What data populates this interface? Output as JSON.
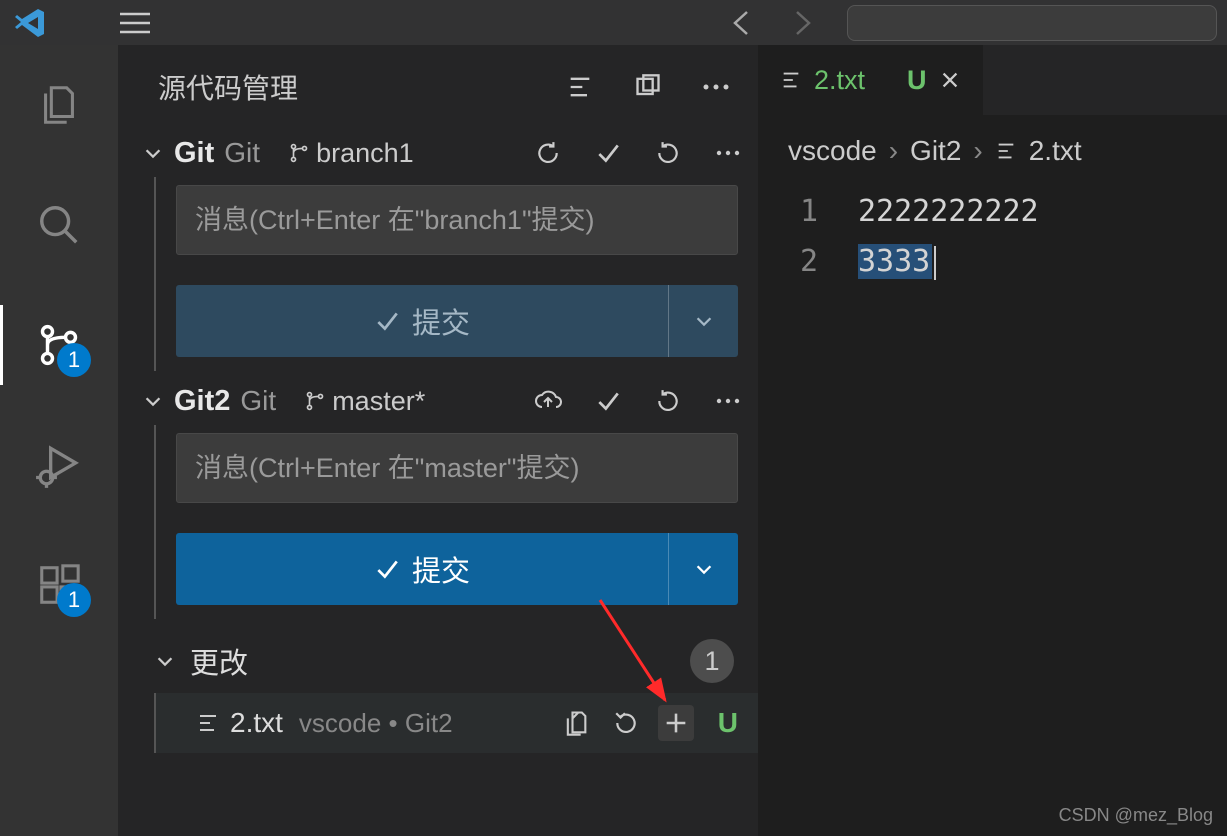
{
  "titleBar": {
    "menuGlyph": "≡"
  },
  "activityBar": {
    "scmBadge": "1",
    "extBadge": "1"
  },
  "panel": {
    "title": "源代码管理"
  },
  "repos": [
    {
      "name": "Git",
      "provider": "Git",
      "branch": "branch1",
      "commitPlaceholder": "消息(Ctrl+Enter 在\"branch1\"提交)",
      "commitLabel": "提交",
      "dim": true,
      "showSync": true,
      "showPublish": false
    },
    {
      "name": "Git2",
      "provider": "Git",
      "branch": "master*",
      "commitPlaceholder": "消息(Ctrl+Enter 在\"master\"提交)",
      "commitLabel": "提交",
      "dim": false,
      "showSync": false,
      "showPublish": true
    }
  ],
  "changes": {
    "label": "更改",
    "count": "1",
    "file": {
      "name": "2.txt",
      "path": "vscode • Git2",
      "status": "U"
    }
  },
  "editor": {
    "tab": {
      "name": "2.txt",
      "status": "U"
    },
    "breadcrumb": [
      "vscode",
      "Git2",
      "2.txt"
    ],
    "lines": [
      {
        "num": "1",
        "text": "2222222222"
      },
      {
        "num": "2",
        "text": "3333"
      }
    ]
  },
  "watermark": "CSDN @mez_Blog"
}
